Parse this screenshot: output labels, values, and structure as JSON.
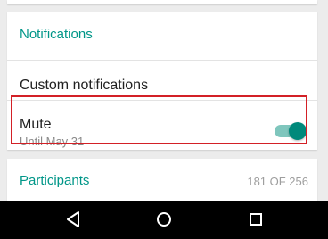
{
  "notifications": {
    "header": "Notifications",
    "custom_label": "Custom notifications",
    "mute": {
      "title": "Mute",
      "subtitle": "Until May 31",
      "enabled": true
    }
  },
  "participants": {
    "header": "Participants",
    "count": "181 OF 256"
  },
  "colors": {
    "accent": "#009688",
    "toggle_thumb": "#00897b",
    "toggle_track": "#7fc6bd",
    "highlight": "#d32026",
    "navbar": "#000000"
  },
  "navbar": {
    "back_icon": "back-triangle-icon",
    "home_icon": "home-circle-icon",
    "recents_icon": "recents-square-icon"
  }
}
